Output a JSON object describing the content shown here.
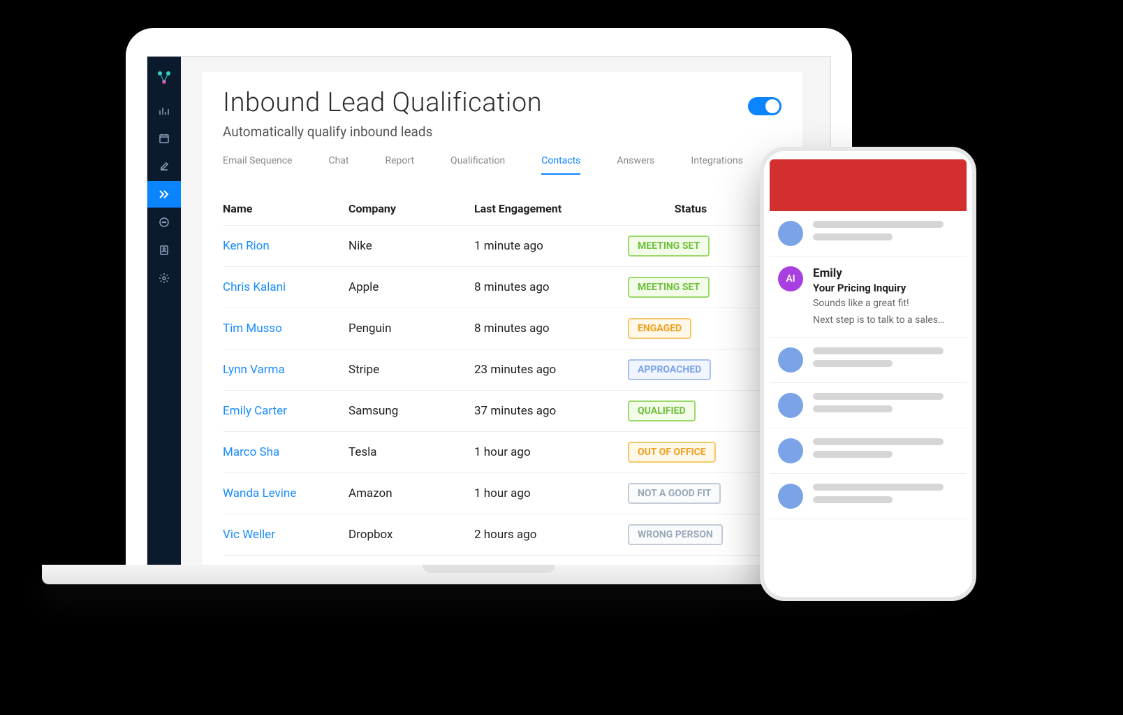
{
  "page": {
    "title": "Inbound Lead Qualification",
    "subtitle": "Automatically qualify inbound leads"
  },
  "tabs": [
    {
      "label": "Email Sequence"
    },
    {
      "label": "Chat"
    },
    {
      "label": "Report"
    },
    {
      "label": "Qualification"
    },
    {
      "label": "Contacts",
      "active": true
    },
    {
      "label": "Answers"
    },
    {
      "label": "Integrations"
    }
  ],
  "table": {
    "headers": {
      "name": "Name",
      "company": "Company",
      "engagement": "Last Engagement",
      "status": "Status"
    },
    "rows": [
      {
        "name": "Ken Rion",
        "company": "Nike",
        "engagement": "1 minute ago",
        "status": "MEETING SET",
        "statusClass": "green"
      },
      {
        "name": "Chris Kalani",
        "company": "Apple",
        "engagement": "8 minutes ago",
        "status": "MEETING SET",
        "statusClass": "green"
      },
      {
        "name": "Tim Musso",
        "company": "Penguin",
        "engagement": "8 minutes ago",
        "status": "ENGAGED",
        "statusClass": "orange"
      },
      {
        "name": "Lynn Varma",
        "company": "Stripe",
        "engagement": "23 minutes ago",
        "status": "APPROACHED",
        "statusClass": "blue"
      },
      {
        "name": "Emily Carter",
        "company": "Samsung",
        "engagement": "37 minutes ago",
        "status": "QUALIFIED",
        "statusClass": "green"
      },
      {
        "name": "Marco Sha",
        "company": "Tesla",
        "engagement": "1 hour ago",
        "status": "OUT OF OFFICE",
        "statusClass": "orange"
      },
      {
        "name": "Wanda Levine",
        "company": "Amazon",
        "engagement": "1 hour ago",
        "status": "NOT A GOOD FIT",
        "statusClass": "gray"
      },
      {
        "name": "Vic Weller",
        "company": "Dropbox",
        "engagement": "2 hours ago",
        "status": "WRONG PERSON",
        "statusClass": "gray"
      }
    ]
  },
  "phone": {
    "ai_label": "AI",
    "message": {
      "sender": "Emily",
      "subject": "Your Pricing Inquiry",
      "preview1": "Sounds like a great fit!",
      "preview2": "Next step is to talk to a sales…"
    }
  }
}
